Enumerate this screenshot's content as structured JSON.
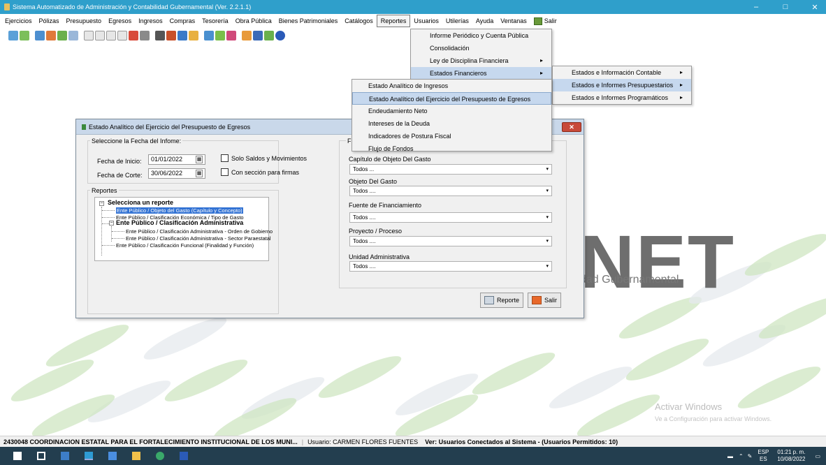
{
  "window": {
    "title": "Sistema Automatizado de Administración y Contabilidad Gubernamental  (Ver. 2.2.1.1)",
    "minimize_glyph": "–",
    "maximize_glyph": "□",
    "close_glyph": "✕"
  },
  "menubar": {
    "items": [
      "Ejercicios",
      "Pólizas",
      "Presupuesto",
      "Egresos",
      "Ingresos",
      "Compras",
      "Tesorería",
      "Obra Pública",
      "Bienes Patrimoniales",
      "Catálogos",
      "Reportes",
      "Usuarios",
      "Utilerías",
      "Ayuda",
      "Ventanas",
      "Salir"
    ],
    "active": "Reportes"
  },
  "reportes_menu": {
    "items": [
      "Informe Periódico y Cuenta Pública",
      "Consolidación",
      "Ley de Disciplina Financiera",
      "Estados Financieros"
    ],
    "highlighted": "Estados Financieros"
  },
  "estados_financieros_menu": {
    "items": [
      "Estados e Información Contable",
      "Estados e Informes Presupuestarios",
      "Estados e Informes Programáticos"
    ],
    "highlighted": "Estados e Informes Presupuestarios"
  },
  "presupuestarios_menu": {
    "items": [
      "Estado Analítico de Ingresos",
      "Estado Analítico del Ejercicio del Presupuesto de Egresos",
      "Endeudamiento Neto",
      "Intereses de la Deuda",
      "Indicadores de Postura Fiscal",
      "Flujo de Fondos"
    ],
    "highlighted": "Estado Analítico del Ejercicio del Presupuesto de Egresos"
  },
  "dialog": {
    "title": "Estado Analítico del Ejercicio del Presupuesto de Egresos",
    "close_glyph": "✕",
    "fecha_group": "Seleccione la Fecha del Infome:",
    "fecha_inicio_label": "Fecha de Inicio:",
    "fecha_inicio_value": "01/01/2022",
    "fecha_corte_label": "Fecha de Corte:",
    "fecha_corte_value": "30/06/2022",
    "solo_saldos_label": "Solo Saldos y Movimientos",
    "firmas_label": "Con sección para firmas",
    "reportes_group": "Reportes",
    "filtros_group": "F",
    "tree": {
      "root": "Selecciona un reporte",
      "items": [
        "Ente Público / Objeto del Gasto (Capítulo y Concepto)",
        "Ente Público / Clasificación Económica / Tipo de Gasto"
      ],
      "group": "Ente Público / Clasificación Administrativa",
      "group_items": [
        "Ente Público / Clasificación Administrativa - Orden de Gobierno",
        "Ente Público / Clasificación Administrativa - Sector Paraestatal"
      ],
      "last": "Ente Público / Clasificación Funcional (Finalidad y Función)"
    },
    "filters": [
      {
        "label": "Capítulo de Objeto Del Gasto",
        "value": "Todos ..."
      },
      {
        "label": "Objeto Del Gasto",
        "value": "Todos ...."
      },
      {
        "label": "Fuente de Financiamiento",
        "value": "Todos ...."
      },
      {
        "label": "Proyecto / Proceso",
        "value": "Todos ...."
      },
      {
        "label": "Unidad Administrativa",
        "value": "Todos ...."
      }
    ],
    "reporte_button": "Reporte",
    "salir_button": "Salir"
  },
  "background": {
    "logo": "NET",
    "logo_subtitle": "dad Gubernamental",
    "activate_title": "Activar Windows",
    "activate_text": "Ve a Configuración para activar Windows."
  },
  "statusbar": {
    "entity": "2430048 COORDINACION ESTATAL PARA EL FORTALECIMIENTO INSTITUCIONAL DE LOS MUNI...",
    "user": "Usuario: CARMEN FLORES FUENTES",
    "connected": "Ver: Usuarios Conectados al Sistema - (Usuarios Permitidos: 10)"
  },
  "taskbar": {
    "lang_top": "ESP",
    "lang_bottom": "ES",
    "time": "01:21 p. m.",
    "date": "10/08/2022"
  },
  "colors": {
    "titlebar": "#2f9fcb",
    "taskbar": "#233e4f",
    "selection": "#3373d4",
    "menu_highlight": "#c6d8ee"
  }
}
